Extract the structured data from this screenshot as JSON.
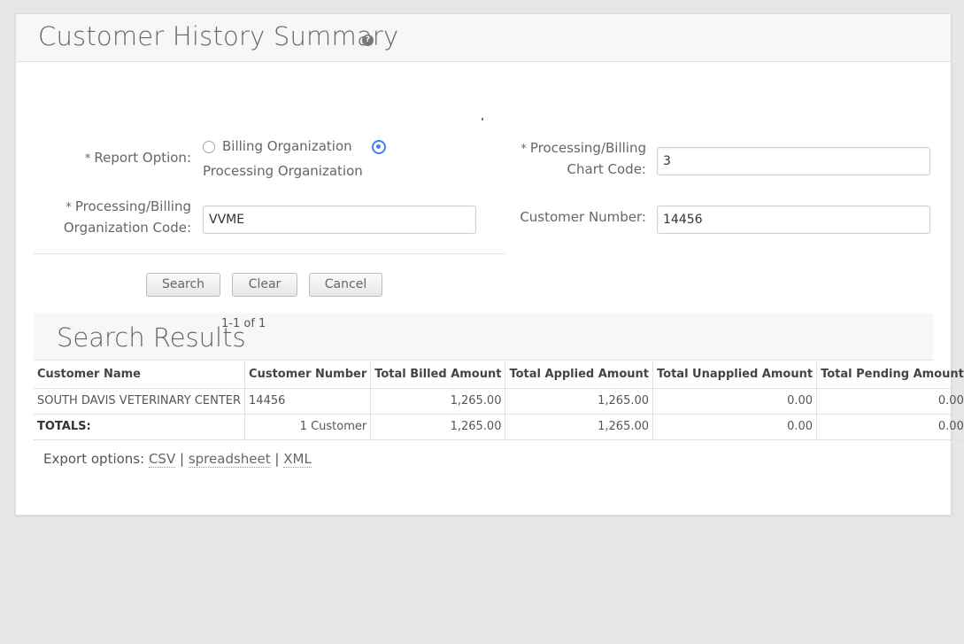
{
  "header": {
    "title": "Customer History Summary",
    "help_icon": "question-icon"
  },
  "form": {
    "report_option": {
      "required_mark": "*",
      "label": "Report Option:",
      "options": [
        "Billing Organization",
        "Processing Organization"
      ],
      "selected": "Processing Organization"
    },
    "chart_code": {
      "required_mark": "*",
      "label_line1": "Processing/Billing",
      "label_line2": "Chart Code:",
      "value": "3"
    },
    "org_code": {
      "required_mark": "*",
      "label_line1": "Processing/Billing",
      "label_line2": "Organization Code:",
      "value": "VVME"
    },
    "customer_number": {
      "label": "Customer Number:",
      "value": "14456"
    }
  },
  "buttons": {
    "search": "Search",
    "clear": "Clear",
    "cancel": "Cancel"
  },
  "results": {
    "title": "Search Results",
    "pager": "1-1 of 1",
    "columns": [
      "Customer Name",
      "Customer Number",
      "Total Billed Amount",
      "Total Applied Amount",
      "Total Unapplied Amount",
      "Total Pending Amount"
    ],
    "rows": [
      [
        "SOUTH DAVIS VETERINARY CENTER",
        "14456",
        "1,265.00",
        "1,265.00",
        "0.00",
        "0.00"
      ]
    ],
    "totals": [
      "TOTALS:",
      "1 Customer",
      "1,265.00",
      "1,265.00",
      "0.00",
      "0.00"
    ]
  },
  "export": {
    "label": "Export options:",
    "options": [
      "CSV",
      "spreadsheet",
      "XML"
    ],
    "separator": "|"
  }
}
